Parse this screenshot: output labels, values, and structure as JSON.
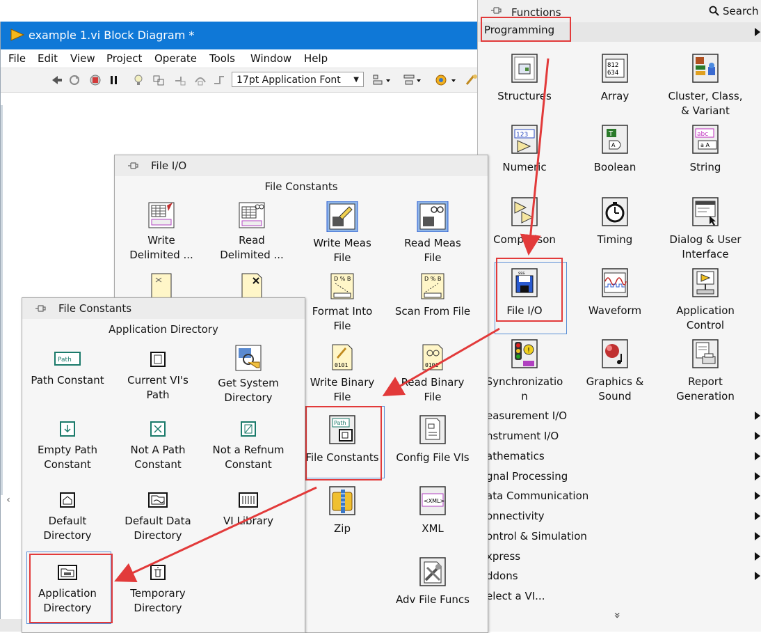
{
  "block_diagram": {
    "title": "example 1.vi Block Diagram *",
    "menu": [
      "File",
      "Edit",
      "View",
      "Project",
      "Operate",
      "Tools",
      "Window",
      "Help"
    ],
    "font_select": "17pt Application Font",
    "scroll_left": "‹"
  },
  "functions": {
    "title": "Functions",
    "search": "Search",
    "programming": "Programming",
    "items": [
      {
        "label": "Structures"
      },
      {
        "label": "Array"
      },
      {
        "label": "Cluster, Class,\n& Variant"
      },
      {
        "label": "Numeric"
      },
      {
        "label": "Boolean"
      },
      {
        "label": "String"
      },
      {
        "label": "Comparison"
      },
      {
        "label": "Timing"
      },
      {
        "label": "Dialog & User\nInterface"
      },
      {
        "label": "File I/O"
      },
      {
        "label": "Waveform"
      },
      {
        "label": "Application\nControl"
      },
      {
        "label": "Synchronizatio\nn"
      },
      {
        "label": "Graphics &\nSound"
      },
      {
        "label": "Report\nGeneration"
      }
    ],
    "categories": [
      "easurement I/O",
      "nstrument I/O",
      "athematics",
      "gnal Processing",
      "ata Communication",
      "onnectivity",
      "ontrol & Simulation",
      "xpress",
      "ddons",
      "elect a VI..."
    ],
    "more": "»"
  },
  "file_io": {
    "title": "File I/O",
    "subtitle": "File Constants",
    "items": [
      {
        "label": "Write\nDelimited ..."
      },
      {
        "label": "Read\nDelimited ..."
      },
      {
        "label": "Write Meas\nFile"
      },
      {
        "label": "Read Meas\nFile"
      },
      {
        "label": ""
      },
      {
        "label": ""
      },
      {
        "label": "Format Into\nFile"
      },
      {
        "label": "Scan From File"
      },
      {
        "label": ""
      },
      {
        "label": ""
      },
      {
        "label": "Write Binary\nFile"
      },
      {
        "label": "Read Binary\nFile"
      },
      {
        "label": "File Constants"
      },
      {
        "label": "Config File VIs"
      },
      {
        "label": "Zip"
      },
      {
        "label": "XML"
      },
      {
        "label": "Adv File Funcs"
      }
    ]
  },
  "file_constants": {
    "title": "File Constants",
    "subtitle": "Application Directory",
    "items": [
      {
        "label": "Path Constant"
      },
      {
        "label": "Current VI's\nPath"
      },
      {
        "label": "Get System\nDirectory"
      },
      {
        "label": "Empty Path\nConstant"
      },
      {
        "label": "Not A Path\nConstant"
      },
      {
        "label": "Not a Refnum\nConstant"
      },
      {
        "label": "Default\nDirectory"
      },
      {
        "label": "Default Data\nDirectory"
      },
      {
        "label": "VI Library"
      },
      {
        "label": "Application\nDirectory"
      },
      {
        "label": "Temporary\nDirectory"
      }
    ]
  },
  "colors": {
    "title_bar": "#0f78d7",
    "highlight_red": "#e23a3a",
    "selection_blue": "#5a8fd6"
  }
}
